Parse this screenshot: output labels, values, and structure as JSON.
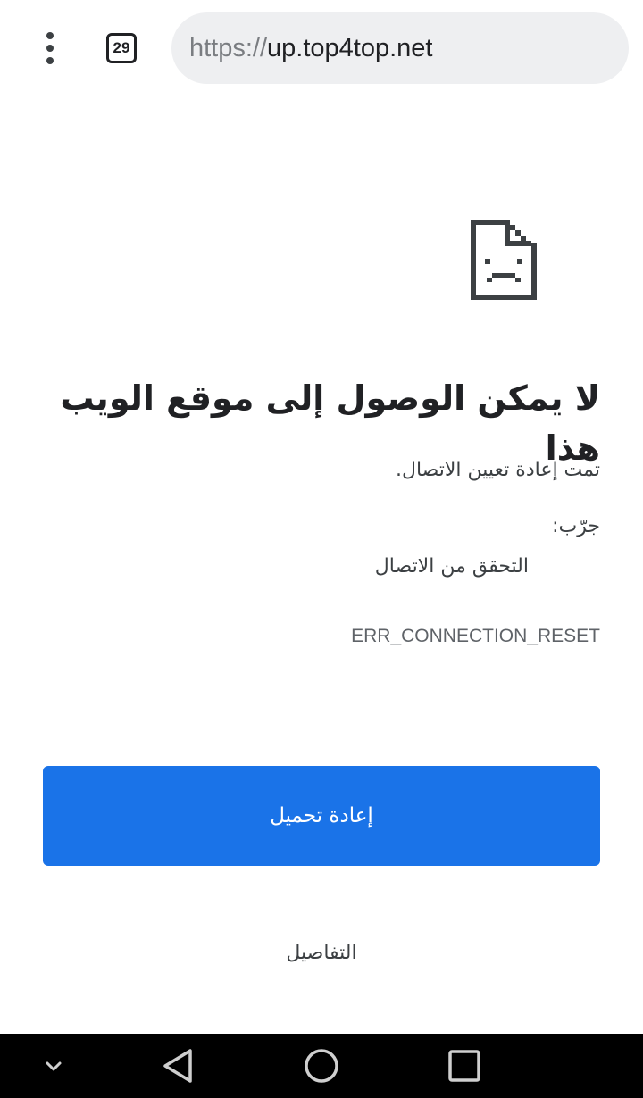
{
  "browser": {
    "url_scheme": "https://",
    "url_host": "up.top4top.net",
    "tab_count": "29",
    "icons": {
      "menu": "more-vert-icon",
      "tabs": "tab-switcher-icon"
    }
  },
  "error": {
    "icon": "sad-document-icon",
    "title": "لا يمكن الوصول إلى موقع الويب هذا",
    "subtitle": "تمت إعادة تعيين الاتصال.",
    "try_label": "جرّب:",
    "suggestions": [
      "التحقق من الاتصال"
    ],
    "code": "ERR_CONNECTION_RESET"
  },
  "actions": {
    "reload_label": "إعادة تحميل",
    "details_label": "التفاصيل"
  },
  "navbar": {
    "icons": [
      "chevron-down-icon",
      "back-triangle-icon",
      "home-circle-icon",
      "recents-square-icon"
    ]
  },
  "colors": {
    "accent": "#1a73e8",
    "url_bar_bg": "#eeeff1",
    "text_primary": "#202124",
    "text_secondary": "#3c4043",
    "navbar_bg": "#000000"
  }
}
